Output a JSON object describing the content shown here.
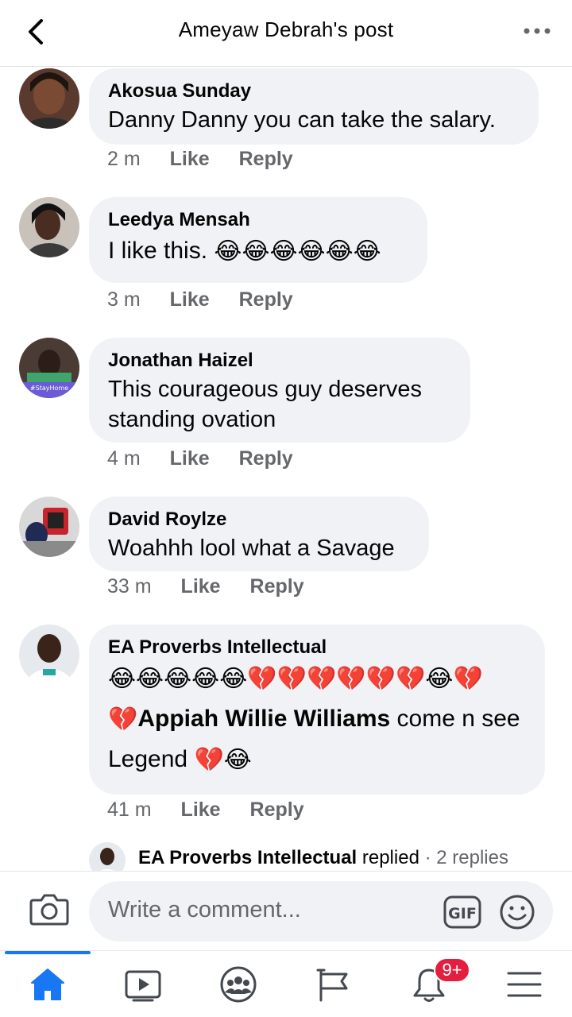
{
  "header": {
    "title": "Ameyaw Debrah's post"
  },
  "comments": [
    {
      "author": "Akosua Sunday",
      "text": "Danny Danny you can take the salary.",
      "time": "2 m",
      "like_label": "Like",
      "reply_label": "Reply"
    },
    {
      "author": "Leedya Mensah",
      "text": "I like this.",
      "emojis": "😂😂😂😂😂😂",
      "time": "3 m",
      "like_label": "Like",
      "reply_label": "Reply"
    },
    {
      "author": "Jonathan Haizel",
      "text_line1": "This courageous guy  deserves",
      "text_line2": "standing ovation",
      "time": "4 m",
      "like_label": "Like",
      "reply_label": "Reply",
      "avatar_frame_text": "#StayHome"
    },
    {
      "author": "David Roylze",
      "text": "Woahhh lool what a Savage",
      "time": "33 m",
      "like_label": "Like",
      "reply_label": "Reply"
    },
    {
      "author": "EA Proverbs Intellectual",
      "emoji_line": "😂😂😂😂😂💔💔💔💔💔💔😂💔",
      "mention_prefix_emoji": "💔",
      "mention": "Appiah Willie Williams",
      "after_mention": " come n see",
      "line3_text": "Legend ",
      "line3_emojis": "💔😂",
      "time": "41 m",
      "like_label": "Like",
      "reply_label": "Reply"
    }
  ],
  "reply_thread": {
    "name": "EA Proverbs Intellectual",
    "action": " replied",
    "count": " · 2 replies"
  },
  "composer": {
    "placeholder": "Write a comment...",
    "gif_label": "GIF"
  },
  "tabbar": {
    "items": [
      "home-icon",
      "watch-icon",
      "groups-icon",
      "pages-icon",
      "notifications-icon",
      "menu-icon"
    ],
    "active": "home-icon",
    "notification_badge": "9+"
  },
  "colors": {
    "accent": "#1877f2",
    "bubble": "#f0f2f5",
    "meta_text": "#65676b",
    "badge": "#e41e3f"
  }
}
